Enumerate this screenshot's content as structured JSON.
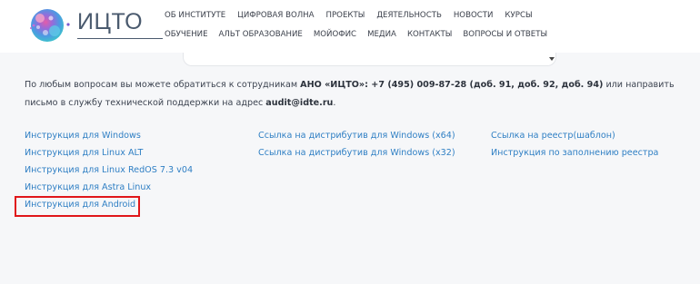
{
  "logo": {
    "text": "ИЦТО"
  },
  "nav": {
    "row1": [
      "ОБ ИНСТИТУТЕ",
      "ЦИФРОВАЯ ВОЛНА",
      "ПРОЕКТЫ",
      "ДЕЯТЕЛЬНОСТЬ",
      "НОВОСТИ",
      "КУРСЫ"
    ],
    "row2": [
      "ОБУЧЕНИЕ",
      "АЛЬТ ОБРАЗОВАНИЕ",
      "МОЙОФИС",
      "МЕДИА",
      "КОНТАКТЫ",
      "ВОПРОСЫ И ОТВЕТЫ"
    ]
  },
  "info": {
    "text_before": "По любым вопросам вы можете обратиться к сотрудникам ",
    "org_phone": "АНО «ИЦТО»: +7 (495) 009-87-28 (доб. 91, доб. 92, доб. 94)",
    "text_middle": " или направить письмо в службу технической поддержки на адрес ",
    "email": "audit@idte.ru",
    "text_after": "."
  },
  "links": {
    "col1": [
      "Инструкция для Windows",
      "Инструкция для Linux ALT",
      "Инструкция для Linux RedOS 7.3 v04",
      "Инструкция для Astra Linux",
      "Инструкция для Android"
    ],
    "col2": [
      "Ссылка на дистрибутив для Windows (x64)",
      "Ссылка на дистрибутив для Windows (x32)"
    ],
    "col3": [
      "Ссылка на реестр(шаблон)",
      "Инструкция по заполнению реестра"
    ]
  },
  "colors": {
    "link": "#2f7fc4",
    "highlight": "#e0161a",
    "logo_text": "#4a5a6e"
  },
  "icons": {
    "logo": "globe-logo-icon",
    "dropdown": "chevron-down-icon"
  }
}
